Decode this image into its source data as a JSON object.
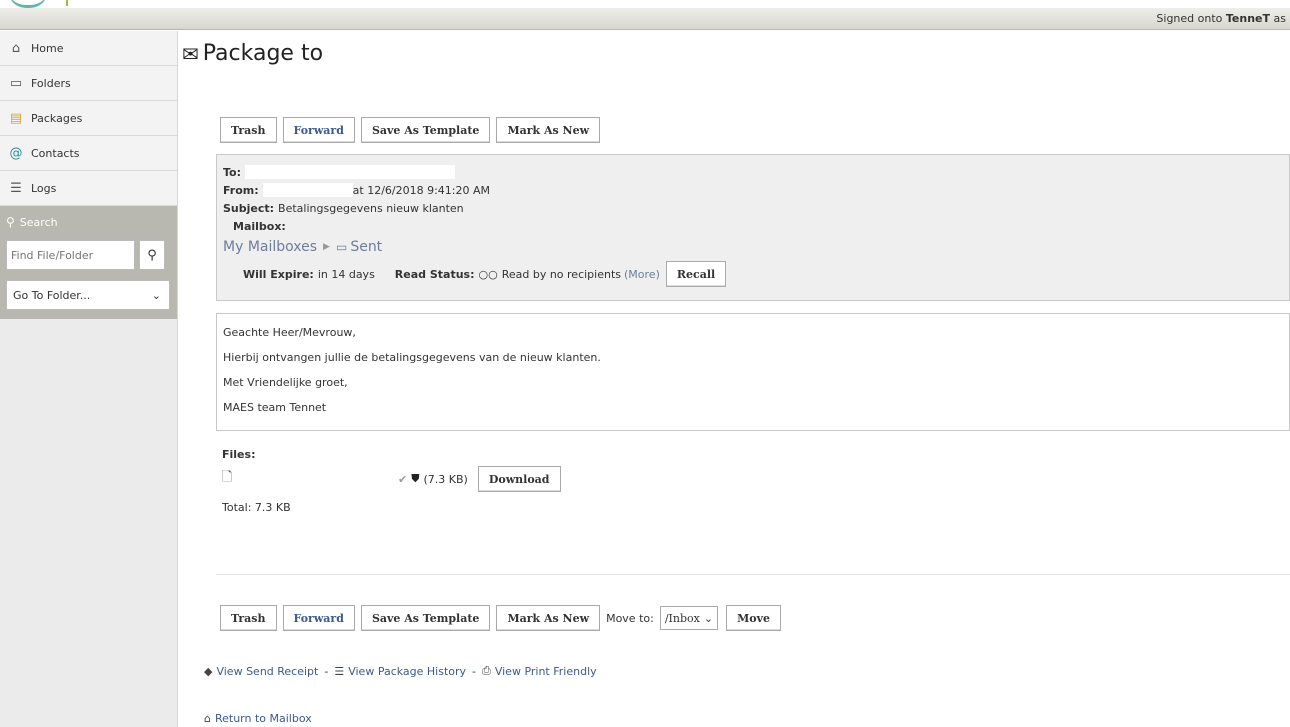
{
  "topbar": {
    "signed_prefix": "Signed onto ",
    "signed_org": "TenneT",
    "signed_suffix": " as"
  },
  "sidebar": {
    "items": [
      {
        "label": "Home",
        "icon": "home-icon"
      },
      {
        "label": "Folders",
        "icon": "folder-icon"
      },
      {
        "label": "Packages",
        "icon": "package-icon"
      },
      {
        "label": "Contacts",
        "icon": "contacts-icon"
      },
      {
        "label": "Logs",
        "icon": "logs-icon"
      }
    ],
    "search_title": "Search",
    "search_placeholder": "Find File/Folder",
    "goto_label": "Go To Folder..."
  },
  "page": {
    "title": "Package to"
  },
  "toolbar": {
    "trash": "Trash",
    "forward": "Forward",
    "save_template": "Save As Template",
    "mark_new": "Mark As New",
    "move_to_label": "Move to:",
    "move_to_value": "/Inbox",
    "move": "Move"
  },
  "header": {
    "to_label": "To:",
    "from_label": "From:",
    "from_time": "at 12/6/2018 9:41:20 AM",
    "subject_label": "Subject:",
    "subject": "Betalingsgegevens nieuw klanten",
    "mailbox_label": "Mailbox:",
    "mailbox_root": "My Mailboxes",
    "mailbox_folder": "Sent",
    "expire_label": "Will Expire:",
    "expire_value": "in 14 days",
    "read_label": "Read Status:",
    "read_value": "Read by no recipients",
    "more": "(More)",
    "recall": "Recall"
  },
  "body": {
    "lines": [
      "Geachte Heer/Mevrouw,",
      "Hierbij ontvangen jullie de betalingsgegevens van de nieuw klanten.",
      "Met Vriendelijke groet,",
      "MAES team Tennet"
    ]
  },
  "files": {
    "title": "Files:",
    "size": "(7.3 KB)",
    "download": "Download",
    "total": "Total: 7.3 KB"
  },
  "links": {
    "send_receipt": "View Send Receipt",
    "history": "View Package History",
    "print": "View Print Friendly",
    "return": "Return to Mailbox"
  }
}
